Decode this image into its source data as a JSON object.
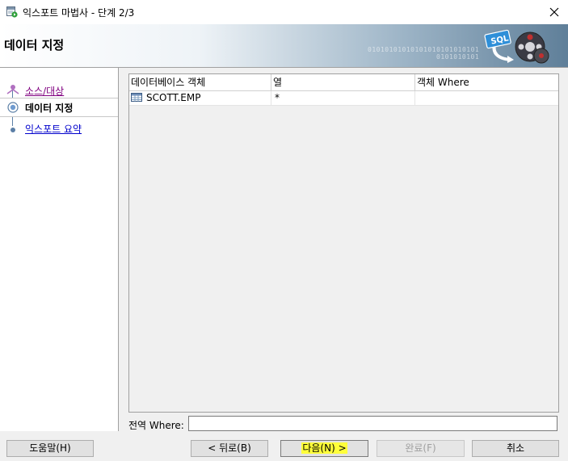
{
  "window": {
    "title": "익스포트 마법사 - 단계 2/3",
    "close_glyph": "✕"
  },
  "banner": {
    "heading": "데이터 지정",
    "decor_binary": [
      "01010101010101010101010101",
      "0101010101"
    ],
    "icon": "sql-wizard-graphic",
    "logo_text": "SQL"
  },
  "steps": [
    {
      "label": "소스/대상",
      "state": "visited",
      "icon": "person-step-icon"
    },
    {
      "label": "데이터 지정",
      "state": "current",
      "icon": "current-step-icon"
    },
    {
      "label": "익스포트 요약",
      "state": "next",
      "icon": "step-dot-icon"
    }
  ],
  "table": {
    "headers": [
      "데이터베이스 객체",
      "열",
      "객체 Where"
    ],
    "rows": [
      {
        "object": "SCOTT.EMP",
        "columns": "*",
        "where": ""
      }
    ]
  },
  "global_where": {
    "label": "전역 Where:",
    "value": ""
  },
  "buttons": {
    "help": "도움말(H)",
    "back": "< 뒤로(B)",
    "next": "다음(N) >",
    "finish": "완료(F)",
    "cancel": "취소"
  },
  "colors": {
    "highlight": "#ffff3a",
    "link": "#0000cc",
    "visited_link": "#800080",
    "banner_right": "#5f7f99"
  }
}
